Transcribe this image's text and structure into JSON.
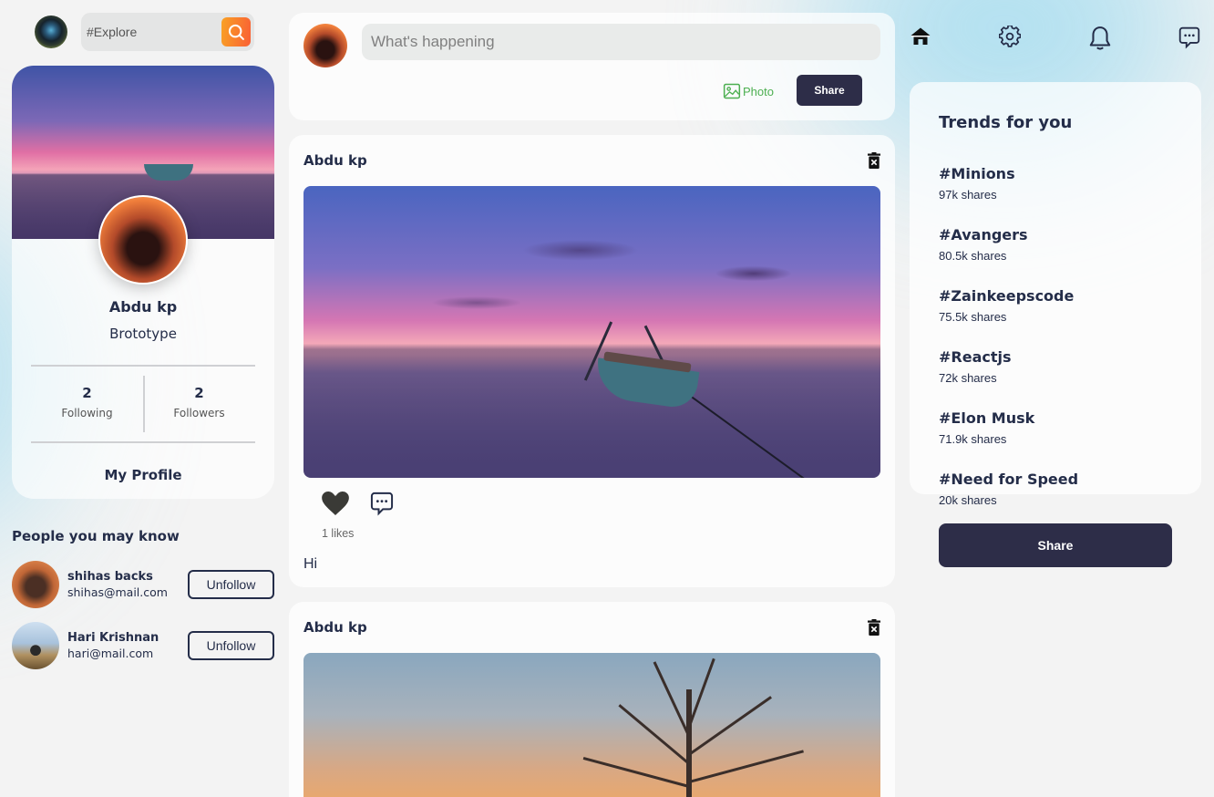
{
  "search": {
    "placeholder": "#Explore"
  },
  "profile": {
    "name": "Abdu kp",
    "subtitle": "Brototype",
    "following_count": "2",
    "following_label": "Following",
    "followers_count": "2",
    "followers_label": "Followers",
    "link_label": "My Profile"
  },
  "people": {
    "title": "People you may know",
    "items": [
      {
        "name": "shihas backs",
        "email": "shihas@mail.com",
        "button": "Unfollow"
      },
      {
        "name": "Hari Krishnan",
        "email": "hari@mail.com",
        "button": "Unfollow"
      }
    ]
  },
  "composer": {
    "placeholder": "What's happening",
    "photo_label": "Photo",
    "share_label": "Share"
  },
  "posts": [
    {
      "author": "Abdu kp",
      "likes": "1 likes",
      "caption": "Hi"
    },
    {
      "author": "Abdu kp"
    }
  ],
  "trends": {
    "title": "Trends for you",
    "items": [
      {
        "tag": "#Minions",
        "shares": "97k shares"
      },
      {
        "tag": "#Avangers",
        "shares": "80.5k shares"
      },
      {
        "tag": "#Zainkeepscode",
        "shares": "75.5k shares"
      },
      {
        "tag": "#Reactjs",
        "shares": "72k shares"
      },
      {
        "tag": "#Elon Musk",
        "shares": "71.9k shares"
      },
      {
        "tag": "#Need for Speed",
        "shares": "20k shares"
      }
    ]
  },
  "share_button_label": "Share",
  "colors": {
    "button_dark": "#2d2d48",
    "search_orange": "#f95f35",
    "photo_green": "#4caf50",
    "text": "#242d49"
  },
  "icons": {
    "nav": [
      "home-icon",
      "settings-icon",
      "notification-icon",
      "comment-icon"
    ],
    "post": [
      "heart-icon",
      "comment-icon",
      "trash-icon"
    ]
  }
}
